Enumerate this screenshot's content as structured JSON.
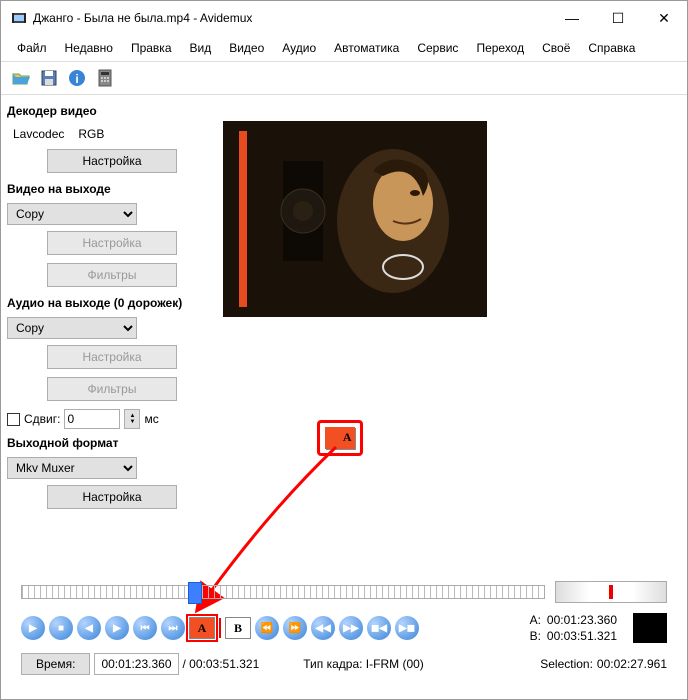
{
  "window": {
    "title": "Джанго - Была не была.mp4 - Avidemux"
  },
  "menu": {
    "items": [
      "Файл",
      "Недавно",
      "Правка",
      "Вид",
      "Видео",
      "Аудио",
      "Автоматика",
      "Сервис",
      "Переход",
      "Своё",
      "Справка"
    ]
  },
  "decoder": {
    "title": "Декодер видео",
    "codec": "Lavcodec",
    "format": "RGB",
    "settings": "Настройка"
  },
  "video_out": {
    "title": "Видео на выходе",
    "value": "Copy",
    "settings": "Настройка",
    "filters": "Фильтры"
  },
  "audio_out": {
    "title": "Аудио на выходе (0 дорожек)",
    "value": "Copy",
    "settings": "Настройка",
    "filters": "Фильтры",
    "shift_label": "Сдвиг:",
    "shift_value": "0",
    "shift_unit": "мс"
  },
  "output_format": {
    "title": "Выходной формат",
    "value": "Mkv Muxer",
    "settings": "Настройка"
  },
  "markers": {
    "a_label": "A:",
    "a_value": "00:01:23.360",
    "b_label": "B:",
    "b_value": "00:03:51.321",
    "sel_label": "Selection:",
    "sel_value": "00:02:27.961"
  },
  "time": {
    "label": "Время:",
    "current": "00:01:23.360",
    "total": "/ 00:03:51.321",
    "frame_type": "Тип кадра:  I-FRM (00)"
  },
  "callout": {
    "letter": "A"
  }
}
